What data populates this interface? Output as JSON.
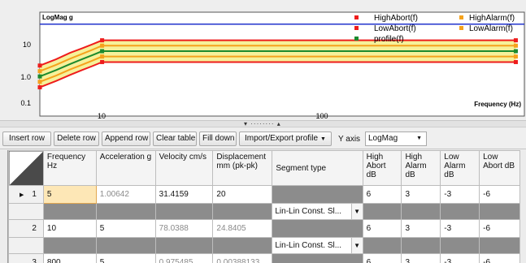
{
  "chart": {
    "y_axis_title": "LogMag g",
    "x_axis_title": "Frequency (Hz)",
    "y_ticks": [
      "10",
      "1.0",
      "0.1"
    ],
    "x_ticks": [
      "10",
      "100"
    ],
    "legend": [
      {
        "label": "HighAbort(f)",
        "color": "#ee1c1c"
      },
      {
        "label": "HighAlarm(f)",
        "color": "#f5a21c"
      },
      {
        "label": "LowAbort(f)",
        "color": "#ee1c1c"
      },
      {
        "label": "LowAlarm(f)",
        "color": "#f5a21c"
      },
      {
        "label": "profile(f)",
        "color": "#1c8a2e"
      }
    ],
    "colors": {
      "abort": "#ee1c1c",
      "alarm": "#f5a21c",
      "profile": "#1c8a2e",
      "reference": "#2233cc",
      "band": "#f6f19a"
    }
  },
  "chart_data": {
    "type": "line",
    "x_scale": "log",
    "y_scale": "log",
    "xlim": [
      5,
      1100
    ],
    "ylim": [
      0.08,
      60
    ],
    "grid": false,
    "legend_position": "top-right",
    "series": [
      {
        "name": "HighAbort(f)",
        "x": [
          5,
          6,
          7,
          8,
          9,
          10,
          1000
        ],
        "y": [
          2.0,
          3.0,
          4.5,
          6.0,
          7.8,
          10,
          10
        ]
      },
      {
        "name": "HighAlarm(f)",
        "x": [
          5,
          6,
          7,
          8,
          9,
          10,
          1000
        ],
        "y": [
          1.4,
          2.1,
          3.1,
          4.2,
          5.5,
          7.1,
          7.1
        ]
      },
      {
        "name": "profile(f)",
        "x": [
          5,
          6,
          7,
          8,
          9,
          10,
          1000
        ],
        "y": [
          1.0,
          1.5,
          2.2,
          3.0,
          3.9,
          5.0,
          5.0
        ]
      },
      {
        "name": "LowAlarm(f)",
        "x": [
          5,
          6,
          7,
          8,
          9,
          10,
          1000
        ],
        "y": [
          0.71,
          1.06,
          1.56,
          2.1,
          2.75,
          3.55,
          3.55
        ]
      },
      {
        "name": "LowAbort(f)",
        "x": [
          5,
          6,
          7,
          8,
          9,
          10,
          1000
        ],
        "y": [
          0.5,
          0.75,
          1.1,
          1.5,
          1.95,
          2.5,
          2.5
        ]
      }
    ],
    "reference_y": 28
  },
  "toolbar": {
    "insert_row": "Insert row",
    "delete_row": "Delete row",
    "append_row": "Append row",
    "clear_table": "Clear table",
    "fill_down": "Fill down",
    "import_export": "Import/Export profile",
    "yaxis_label": "Y axis",
    "yaxis_value": "LogMag"
  },
  "table": {
    "headers": [
      "Frequency Hz",
      "Acceleration g",
      "Velocity cm/s",
      "Displacement mm (pk-pk)",
      "Segment type",
      "High Abort dB",
      "High Alarm dB",
      "Low Alarm dB",
      "Low Abort dB"
    ],
    "rows": [
      {
        "num": "1",
        "frequency": "5",
        "acceleration": "1.00642",
        "velocity": "31.4159",
        "displacement": "20",
        "high_abort": "6",
        "high_alarm": "3",
        "low_alarm": "-3",
        "low_abort": "-6",
        "segment": "Lin-Lin Const. Sl..."
      },
      {
        "num": "2",
        "frequency": "10",
        "acceleration": "5",
        "velocity": "78.0388",
        "displacement": "24.8405",
        "high_abort": "6",
        "high_alarm": "3",
        "low_alarm": "-3",
        "low_abort": "-6",
        "segment": "Lin-Lin Const. Sl..."
      },
      {
        "num": "3",
        "frequency": "800",
        "acceleration": "5",
        "velocity": "0.975485",
        "displacement": "0.00388133",
        "high_abort": "6",
        "high_alarm": "3",
        "low_alarm": "-3",
        "low_abort": "-6"
      }
    ]
  }
}
